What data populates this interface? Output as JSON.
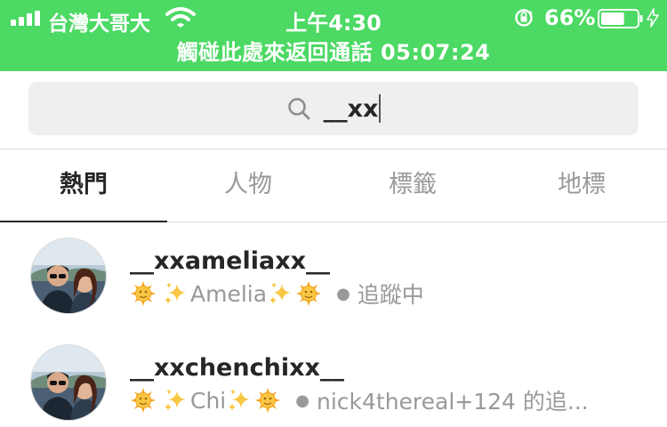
{
  "status_bar": {
    "carrier": "台灣大哥大",
    "time": "上午4:30",
    "battery_percent": "66%",
    "battery_level": 0.66,
    "call_banner": "觸碰此處來返回通話 05:07:24",
    "icons": [
      "signal-icon",
      "wifi-icon",
      "orientation-lock-icon",
      "battery-icon",
      "charging-icon"
    ],
    "background_color": "#4cd964"
  },
  "search": {
    "query": "__xx",
    "icon": "search-icon"
  },
  "tabs": [
    {
      "label": "熱門",
      "active": true
    },
    {
      "label": "人物",
      "active": false
    },
    {
      "label": "標籤",
      "active": false
    },
    {
      "label": "地標",
      "active": false
    }
  ],
  "results": [
    {
      "username": "__xxameliaxx__",
      "name": "Amelia",
      "detail": "追蹤中"
    },
    {
      "username": "__xxchenchixx__",
      "name": "Chi",
      "detail": "nick4thereal+124 的追..."
    }
  ]
}
